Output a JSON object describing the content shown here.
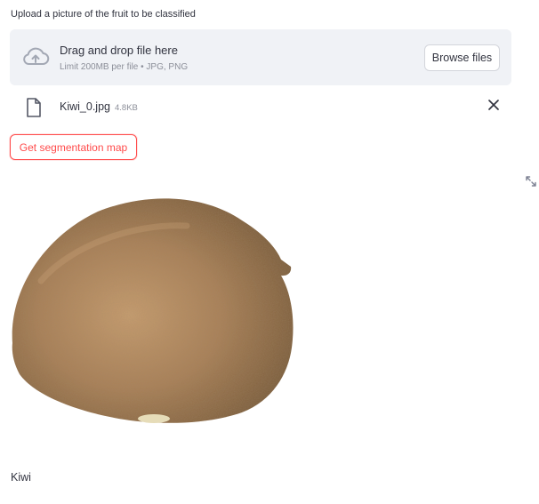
{
  "uploader": {
    "label": "Upload a picture of the fruit to be classified",
    "dropzone_title": "Drag and drop file here",
    "dropzone_limit": "Limit 200MB per file • JPG, PNG",
    "browse_label": "Browse files"
  },
  "file": {
    "name": "Kiwi_0.jpg",
    "size": "4.8KB"
  },
  "actions": {
    "segmentation_label": "Get segmentation map"
  },
  "image": {
    "subject": "kiwi fruit",
    "colors": {
      "skin_dark": "#8b6a43",
      "skin_light": "#c49a6c"
    }
  },
  "result": {
    "prediction": "Kiwi"
  },
  "icons": {
    "upload": "cloud-upload-icon",
    "file": "file-icon",
    "remove": "close-icon",
    "expand": "fullscreen-icon"
  },
  "colors": {
    "accent": "#ff4b4b",
    "dropzone_bg": "#f0f2f6",
    "text": "#31333f",
    "muted_text": "#8c8f99"
  }
}
